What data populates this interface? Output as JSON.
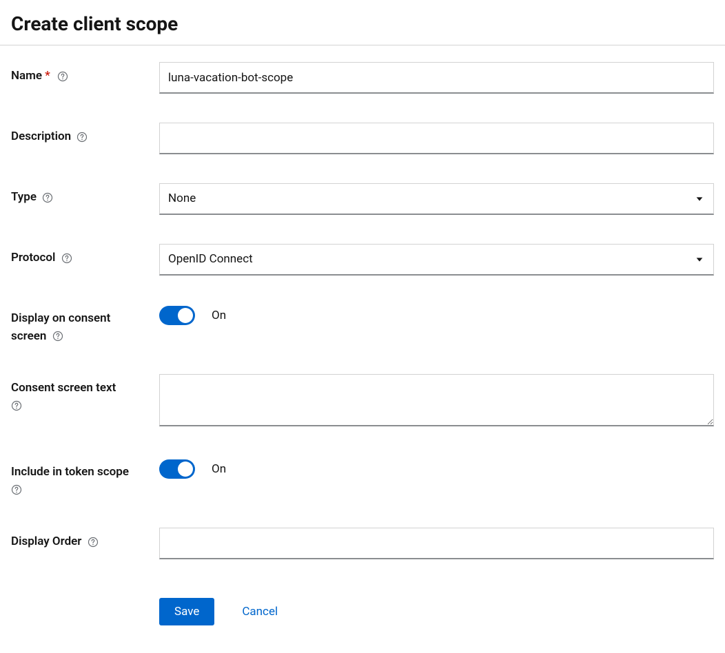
{
  "page": {
    "title": "Create client scope"
  },
  "form": {
    "name": {
      "label": "Name",
      "value": "luna-vacation-bot-scope",
      "required": true
    },
    "description": {
      "label": "Description",
      "value": ""
    },
    "type": {
      "label": "Type",
      "value": "None"
    },
    "protocol": {
      "label": "Protocol",
      "value": "OpenID Connect"
    },
    "displayOnConsent": {
      "label": "Display on consent screen",
      "state": "On",
      "on": true
    },
    "consentText": {
      "label": "Consent screen text",
      "value": ""
    },
    "includeInToken": {
      "label": "Include in token scope",
      "state": "On",
      "on": true
    },
    "displayOrder": {
      "label": "Display Order",
      "value": ""
    }
  },
  "actions": {
    "save": "Save",
    "cancel": "Cancel"
  }
}
